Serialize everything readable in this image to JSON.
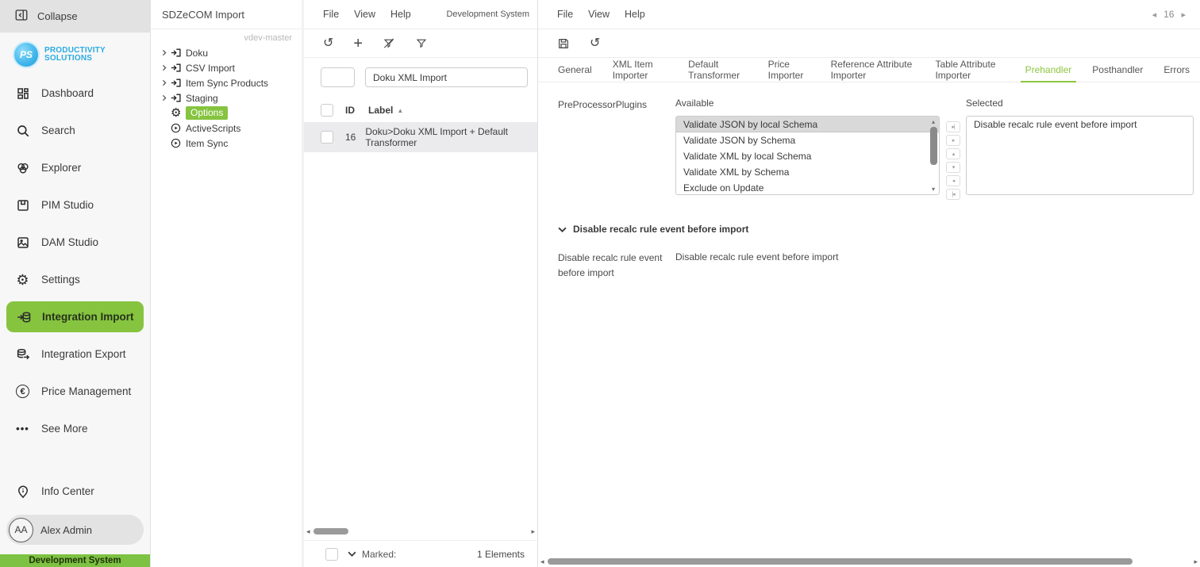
{
  "colors": {
    "accent_green": "#86c440",
    "brand_blue": "#29abe2"
  },
  "sidebar": {
    "collapse_label": "Collapse",
    "brand_initials": "PS",
    "brand_line1": "PRODUCTIVITY",
    "brand_line2": "SOLUTIONS",
    "items": [
      {
        "label": "Dashboard"
      },
      {
        "label": "Search"
      },
      {
        "label": "Explorer"
      },
      {
        "label": "PIM Studio"
      },
      {
        "label": "DAM Studio"
      },
      {
        "label": "Settings"
      },
      {
        "label": "Integration Import",
        "active": true
      },
      {
        "label": "Integration Export"
      },
      {
        "label": "Price Management"
      },
      {
        "label": "See More"
      }
    ],
    "info_center_label": "Info Center",
    "user_initials": "AA",
    "user_name": "Alex Admin",
    "environment_label": "Development System"
  },
  "tree": {
    "title": "SDZeCOM Import",
    "version_tag": "vdev-master",
    "items": [
      {
        "label": "Doku",
        "type": "import"
      },
      {
        "label": "CSV Import",
        "type": "import"
      },
      {
        "label": "Item Sync Products",
        "type": "import"
      },
      {
        "label": "Staging",
        "type": "import"
      },
      {
        "label": "Options",
        "type": "options",
        "highlighted": true
      },
      {
        "label": "ActiveScripts",
        "type": "script"
      },
      {
        "label": "Item Sync",
        "type": "script"
      }
    ]
  },
  "list_panel": {
    "menu": {
      "file": "File",
      "view": "View",
      "help": "Help"
    },
    "system_label": "Development System",
    "search_id_value": "",
    "search_label_value": "Doku XML Import",
    "columns": {
      "id": "ID",
      "label": "Label"
    },
    "rows": [
      {
        "id": "16",
        "label": "Doku>Doku XML Import + Default Transformer"
      }
    ],
    "marked_label": "Marked:",
    "elements_count": "1 Elements"
  },
  "detail_panel": {
    "menu": {
      "file": "File",
      "view": "View",
      "help": "Help"
    },
    "pager_value": "16",
    "tabs": [
      {
        "label": "General"
      },
      {
        "label": "XML Item Importer"
      },
      {
        "label": "Default Transformer"
      },
      {
        "label": "Price Importer"
      },
      {
        "label": "Reference Attribute Importer"
      },
      {
        "label": "Table Attribute Importer"
      },
      {
        "label": "Prehandler",
        "active": true
      },
      {
        "label": "Posthandler"
      },
      {
        "label": "Errors"
      }
    ],
    "preprocessor": {
      "field_label": "PreProcessorPlugins",
      "available_label": "Available",
      "available_options": [
        {
          "label": "Validate JSON by local Schema",
          "selected": true
        },
        {
          "label": "Validate JSON by Schema"
        },
        {
          "label": "Validate XML by local Schema"
        },
        {
          "label": "Validate XML by Schema"
        },
        {
          "label": "Exclude on Update"
        }
      ],
      "selected_label": "Selected",
      "selected_options": [
        {
          "label": "Disable recalc rule event before import"
        }
      ]
    },
    "section": {
      "title": "Disable recalc rule event before import",
      "field_label": "Disable recalc rule event before import",
      "field_value": "Disable recalc rule event before import"
    }
  }
}
